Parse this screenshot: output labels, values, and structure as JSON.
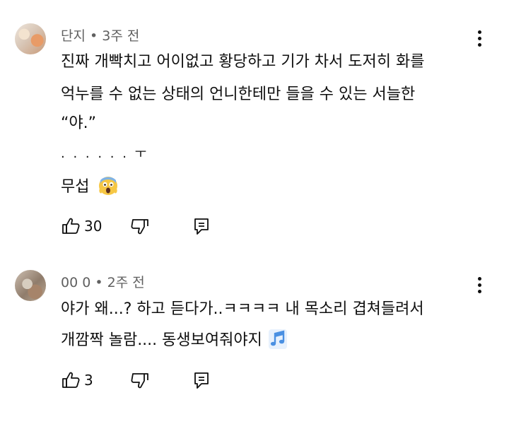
{
  "comments": [
    {
      "author": "단지",
      "separator": "•",
      "time": "3주 전",
      "lines": [
        "진짜 개빡치고 어이없고 황당하고 기가 차서 도저히 화를",
        "억누를 수 없는 상태의 언니한테만 들을 수 있는 서늘한",
        "“야.”",
        ". . . . . .  ㅜ",
        "무섭"
      ],
      "emoji": "face-screaming-in-fear-icon",
      "likes": "30",
      "icons": [
        "thumbs-up-icon",
        "thumbs-down-icon",
        "reply-icon",
        "more-vertical-icon"
      ]
    },
    {
      "author": "00 0",
      "separator": "•",
      "time": "2주 전",
      "lines": [
        "야가 왜...? 하고 듣다가..ㅋㅋㅋㅋ 내 목소리 겹쳐들려서",
        "개깜짝 놀람.... 동생보여줘야지"
      ],
      "emoji": "musical-notes-icon",
      "likes": "3",
      "icons": [
        "thumbs-up-icon",
        "thumbs-down-icon",
        "reply-icon",
        "more-vertical-icon"
      ]
    }
  ],
  "colors": {
    "text": "#0f0f0f",
    "meta": "#606060",
    "note_blue": "#4a90e2",
    "emoji_yellow": "#f6c744"
  }
}
